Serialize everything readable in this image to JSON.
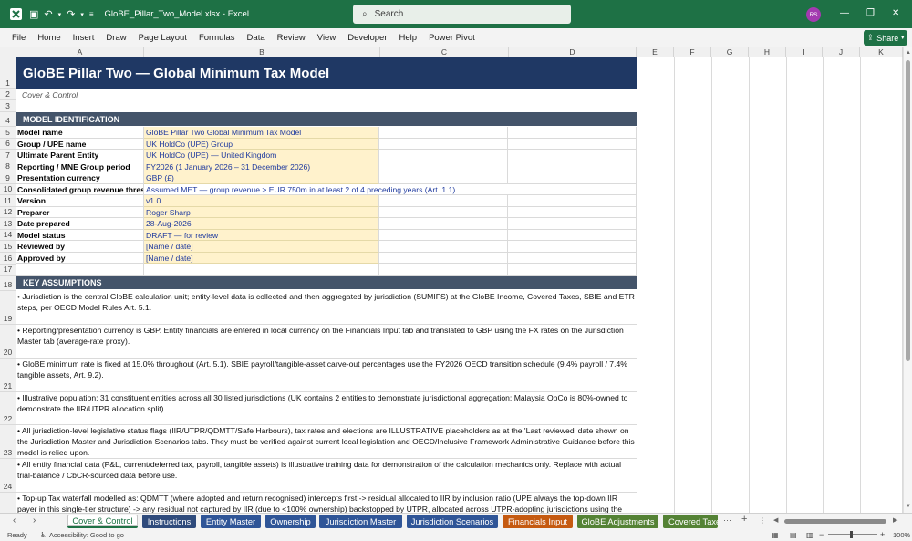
{
  "window": {
    "title": "GloBE_Pillar_Two_Model.xlsx  -  Excel",
    "search_placeholder": "Search",
    "user_initials": "RS"
  },
  "ribbon": {
    "tabs": [
      "File",
      "Home",
      "Insert",
      "Draw",
      "Page Layout",
      "Formulas",
      "Data",
      "Review",
      "View",
      "Developer",
      "Help",
      "Power Pivot"
    ],
    "share_label": "Share"
  },
  "grid": {
    "columns": [
      "A",
      "B",
      "C",
      "D",
      "E",
      "F",
      "G",
      "H",
      "I",
      "J",
      "K"
    ],
    "rows": [
      "1",
      "2",
      "3",
      "4",
      "5",
      "6",
      "7",
      "8",
      "9",
      "10",
      "11",
      "12",
      "13",
      "14",
      "15",
      "16",
      "17",
      "18",
      "19",
      "20",
      "21",
      "22",
      "23",
      "24"
    ]
  },
  "sheet": {
    "title": "GloBE Pillar Two — Global Minimum Tax Model",
    "subtitle": "Cover & Control",
    "section_model": "MODEL IDENTIFICATION",
    "section_assumptions": "KEY ASSUMPTIONS",
    "fields": [
      {
        "label": "Model name",
        "value": "GloBE Pillar Two Global Minimum Tax Model"
      },
      {
        "label": "Group / UPE name",
        "value": "UK HoldCo (UPE) Group"
      },
      {
        "label": "Ultimate Parent Entity",
        "value": "UK HoldCo (UPE) — United Kingdom"
      },
      {
        "label": "Reporting / MNE Group period",
        "value": "FY2026 (1 January 2026 – 31 December 2026)"
      },
      {
        "label": "Presentation currency",
        "value": "GBP (£)"
      },
      {
        "label": "Consolidated group revenue thres",
        "value": "Assumed MET — group revenue > EUR 750m in at least 2 of 4 preceding years (Art. 1.1)"
      },
      {
        "label": "Version",
        "value": "v1.0"
      },
      {
        "label": "Preparer",
        "value": "Roger Sharp"
      },
      {
        "label": "Date prepared",
        "value": "28-Aug-2026"
      },
      {
        "label": "Model status",
        "value": "DRAFT — for review"
      },
      {
        "label": "Reviewed by",
        "value": "[Name / date]"
      },
      {
        "label": "Approved by",
        "value": "[Name / date]"
      }
    ],
    "assumptions": [
      "•  Jurisdiction is the central GloBE calculation unit; entity-level data is collected and then aggregated by jurisdiction (SUMIFS) at the GloBE Income, Covered Taxes, SBIE and ETR steps, per OECD Model Rules Art. 5.1.",
      "•  Reporting/presentation currency is GBP. Entity financials are entered in local currency on the Financials Input tab and translated to GBP using the FX rates on the Jurisdiction Master tab (average-rate proxy).",
      "•  GloBE minimum rate is fixed at 15.0% throughout (Art. 5.1). SBIE payroll/tangible-asset carve-out percentages use the FY2026 OECD transition schedule (9.4% payroll / 7.4% tangible assets, Art. 9.2).",
      "•  Illustrative population: 31 constituent entities across all 30 listed jurisdictions (UK contains 2 entities to demonstrate jurisdictional aggregation; Malaysia OpCo is 80%-owned to demonstrate the IIR/UTPR allocation split).",
      "•  All jurisdiction-level legislative status flags (IIR/UTPR/QDMTT/Safe Harbours), tax rates and elections are ILLUSTRATIVE placeholders as at the 'Last reviewed' date shown on the Jurisdiction Master and Jurisdiction Scenarios tabs. They must be verified against current local legislation and OECD/Inclusive Framework Administrative Guidance before this model is relied upon.",
      "•  All entity financial data (P&L, current/deferred tax, payroll, tangible assets) is illustrative training data for demonstration of the calculation mechanics only. Replace with actual trial-balance / CbCR-sourced data before use.",
      "•  Top-up Tax waterfall modelled as: QDMTT (where adopted and return recognised) intercepts first -> residual allocated to IIR by inclusion ratio (UPE always the top-down IIR payer in this single-tier structure) -> any residual not captured by IIR (due to <100% ownership) backstopped by UTPR, allocated across UTPR-adopting jurisdictions using the"
    ]
  },
  "sheet_tabs": [
    {
      "label": "Cover & Control",
      "color": "#ffffff"
    },
    {
      "label": "Instructions",
      "color": "#2f4b7c"
    },
    {
      "label": "Entity Master",
      "color": "#2f5597"
    },
    {
      "label": "Ownership",
      "color": "#2f5597"
    },
    {
      "label": "Jurisdiction Master",
      "color": "#2f5597"
    },
    {
      "label": "Jurisdiction Scenarios",
      "color": "#2f5597"
    },
    {
      "label": "Financials Input",
      "color": "#c55a11"
    },
    {
      "label": "GloBE Adjustments",
      "color": "#548235"
    },
    {
      "label": "Covered Taxe",
      "color": "#548235"
    }
  ],
  "status": {
    "ready": "Ready",
    "accessibility": "Accessibility: Good to go",
    "zoom": "100%"
  }
}
